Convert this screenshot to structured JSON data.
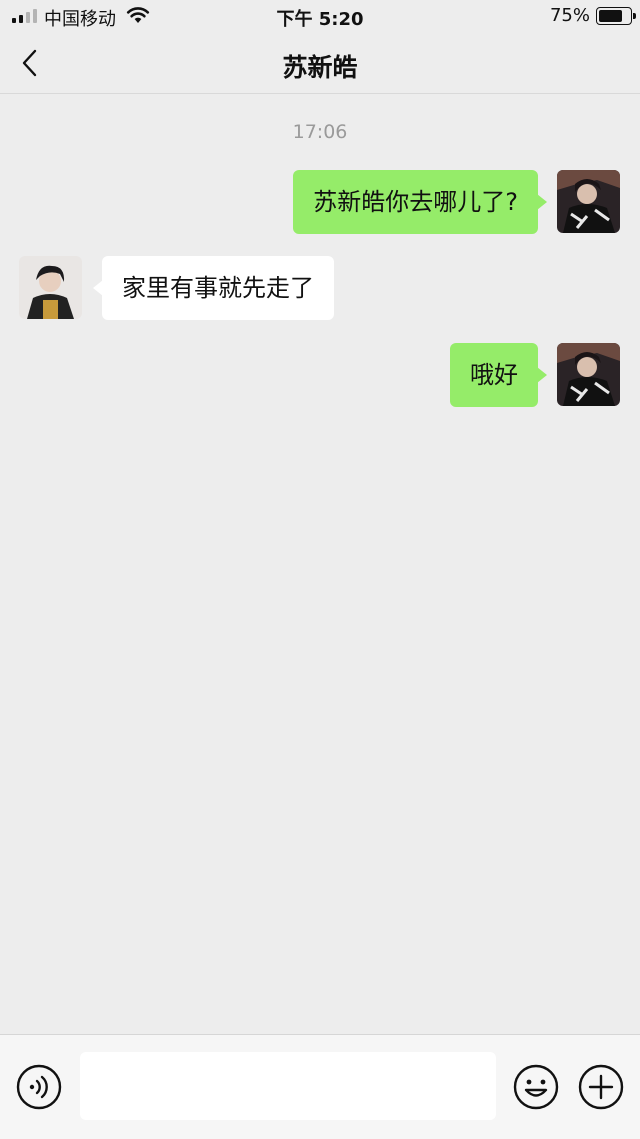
{
  "status_bar": {
    "carrier": "中国移动",
    "time": "下午 5:20",
    "battery_percent_label": "75%",
    "battery_level": 0.75,
    "signal_bars_filled": 2,
    "signal_bars_total": 4
  },
  "header": {
    "title": "苏新皓"
  },
  "chat": {
    "timestamp": "17:06",
    "messages": [
      {
        "direction": "outgoing",
        "text": "苏新皓你去哪儿了?"
      },
      {
        "direction": "incoming",
        "text": "家里有事就先走了"
      },
      {
        "direction": "outgoing",
        "text": "哦好"
      }
    ]
  },
  "input_bar": {
    "value": "",
    "placeholder": ""
  },
  "colors": {
    "background": "#ededed",
    "outgoing_bubble": "#95ec69",
    "incoming_bubble": "#ffffff",
    "timestamp": "#9a9a9a"
  },
  "icons": {
    "back": "chevron-left-icon",
    "voice": "voice-icon",
    "emoji": "smiley-icon",
    "more": "plus-icon"
  }
}
